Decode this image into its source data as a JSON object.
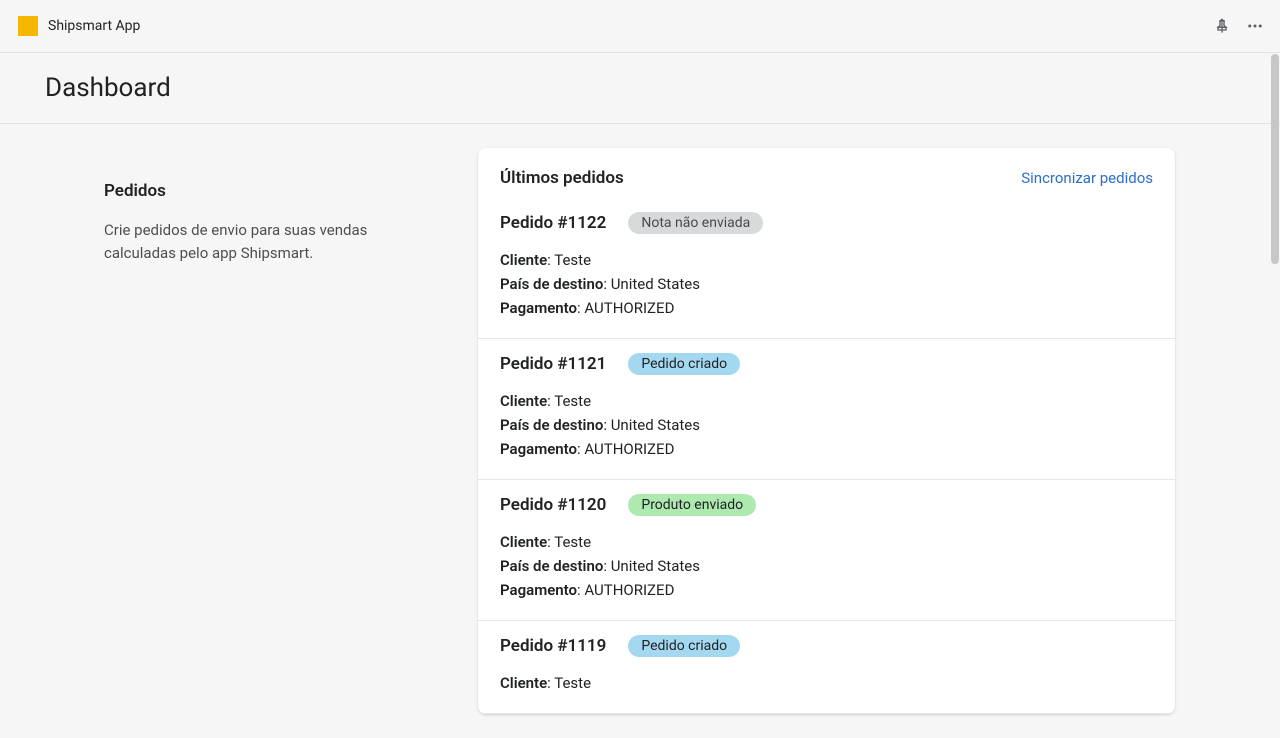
{
  "topbar": {
    "app_name": "Shipsmart App"
  },
  "page": {
    "title": "Dashboard"
  },
  "sidebar": {
    "heading": "Pedidos",
    "description": "Crie pedidos de envio para suas vendas calculadas pelo app Shipsmart."
  },
  "card": {
    "title": "Últimos pedidos",
    "sync_link": "Sincronizar pedidos"
  },
  "labels": {
    "cliente": "Cliente",
    "pais": "País de destino",
    "pagamento": "Pagamento"
  },
  "orders": [
    {
      "title": "Pedido #1122",
      "badge": "Nota não enviada",
      "badge_class": "badge-grey",
      "cliente": "Teste",
      "pais": "United States",
      "pagamento": "AUTHORIZED"
    },
    {
      "title": "Pedido #1121",
      "badge": "Pedido criado",
      "badge_class": "badge-blue",
      "cliente": "Teste",
      "pais": "United States",
      "pagamento": "AUTHORIZED"
    },
    {
      "title": "Pedido #1120",
      "badge": "Produto enviado",
      "badge_class": "badge-green",
      "cliente": "Teste",
      "pais": "United States",
      "pagamento": "AUTHORIZED"
    },
    {
      "title": "Pedido #1119",
      "badge": "Pedido criado",
      "badge_class": "badge-blue",
      "cliente": "Teste",
      "pais": "",
      "pagamento": ""
    }
  ]
}
